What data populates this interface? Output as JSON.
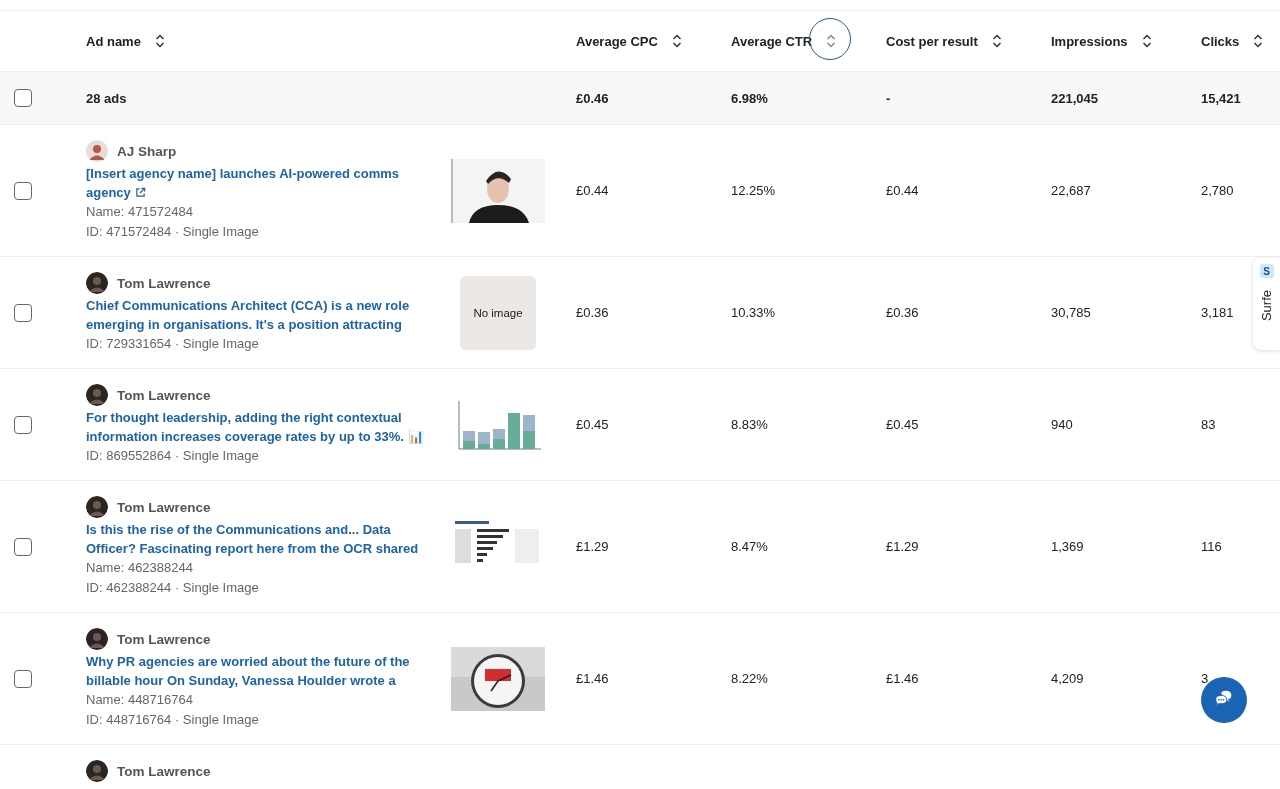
{
  "table": {
    "columns": [
      {
        "label": "Ad name",
        "focused": false
      },
      {
        "label": "Average CPC",
        "focused": false
      },
      {
        "label": "Average CTR",
        "focused": true
      },
      {
        "label": "Cost per result",
        "focused": false
      },
      {
        "label": "Impressions",
        "focused": false
      },
      {
        "label": "Clicks",
        "focused": false
      }
    ],
    "summary": {
      "checked": false,
      "label": "28 ads",
      "values": [
        "£0.46",
        "6.98%",
        "-",
        "221,045",
        "15,421"
      ]
    },
    "rows": [
      {
        "checked": false,
        "author": "AJ Sharp",
        "title": "[Insert agency name] launches AI-powered comms agency",
        "external_link": true,
        "name": "Name: 471572484",
        "meta": "ID: 471572484 · Single Image",
        "thumbnail": {
          "kind": "picture"
        },
        "values": [
          "£0.44",
          "12.25%",
          "£0.44",
          "22,687",
          "2,780"
        ]
      },
      {
        "checked": false,
        "author": "Tom Lawrence",
        "title": "Chief Communications Architect (CCA) is a new role emerging in organisations.  It's a position attracting",
        "meta": "ID: 729331654 · Single Image",
        "thumbnail": {
          "kind": "placeholder",
          "text": "No image"
        },
        "values": [
          "£0.36",
          "10.33%",
          "£0.36",
          "30,785",
          "3,181"
        ]
      },
      {
        "checked": false,
        "author": "Tom Lawrence",
        "title": "For thought leadership, adding the right contextual information increases coverage rates by up to 33%. 📊",
        "meta": "ID: 869552864 · Single Image",
        "thumbnail": {
          "kind": "picture"
        },
        "values": [
          "£0.45",
          "8.83%",
          "£0.45",
          "940",
          "83"
        ]
      },
      {
        "checked": false,
        "author": "Tom Lawrence",
        "title": "Is this the rise of the Communications and... Data Officer? Fascinating report here from the OCR shared",
        "name": "Name: 462388244",
        "meta": "ID: 462388244 · Single Image",
        "thumbnail": {
          "kind": "picture"
        },
        "values": [
          "£1.29",
          "8.47%",
          "£1.29",
          "1,369",
          "116"
        ]
      },
      {
        "checked": false,
        "author": "Tom Lawrence",
        "title": "Why PR agencies are worried about the future of the billable hour On Sunday, Vanessa Houlder wrote a",
        "name": "Name: 448716764",
        "meta": "ID: 448716764 · Single Image",
        "thumbnail": {
          "kind": "picture"
        },
        "values": [
          "£1.46",
          "8.22%",
          "£1.46",
          "4,209",
          "3"
        ]
      },
      {
        "author": "Tom Lawrence"
      }
    ]
  },
  "side_tab": {
    "logo": "S",
    "label": "Surfe"
  }
}
